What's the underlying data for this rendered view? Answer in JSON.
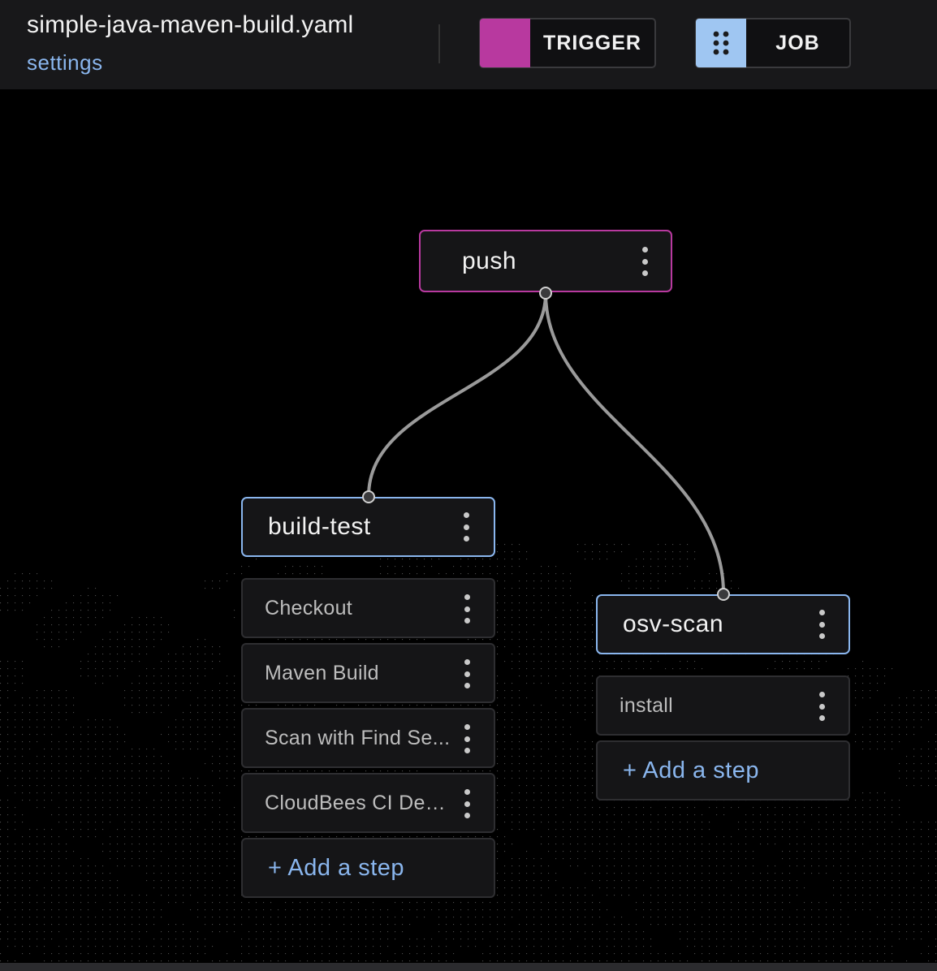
{
  "header": {
    "file_name": "simple-java-maven-build.yaml",
    "settings_label": "settings",
    "trigger_button_label": "TRIGGER",
    "job_button_label": "JOB",
    "trigger_color": "#b8399f",
    "job_color": "#9fc6f2"
  },
  "graph": {
    "trigger": {
      "label": "push"
    },
    "jobs": [
      {
        "label": "build-test",
        "steps": [
          "Checkout",
          "Maven Build",
          "Scan with Find Se...",
          "CloudBees CI Dep..."
        ],
        "add_step_label": "+ Add a step"
      },
      {
        "label": "osv-scan",
        "steps": [
          "install"
        ],
        "add_step_label": "+ Add a step"
      }
    ]
  },
  "colors": {
    "link": "#8ab6ee",
    "job_border": "#8ab6ee",
    "trigger_border": "#b8399f",
    "edge": "#9a9a9a"
  }
}
